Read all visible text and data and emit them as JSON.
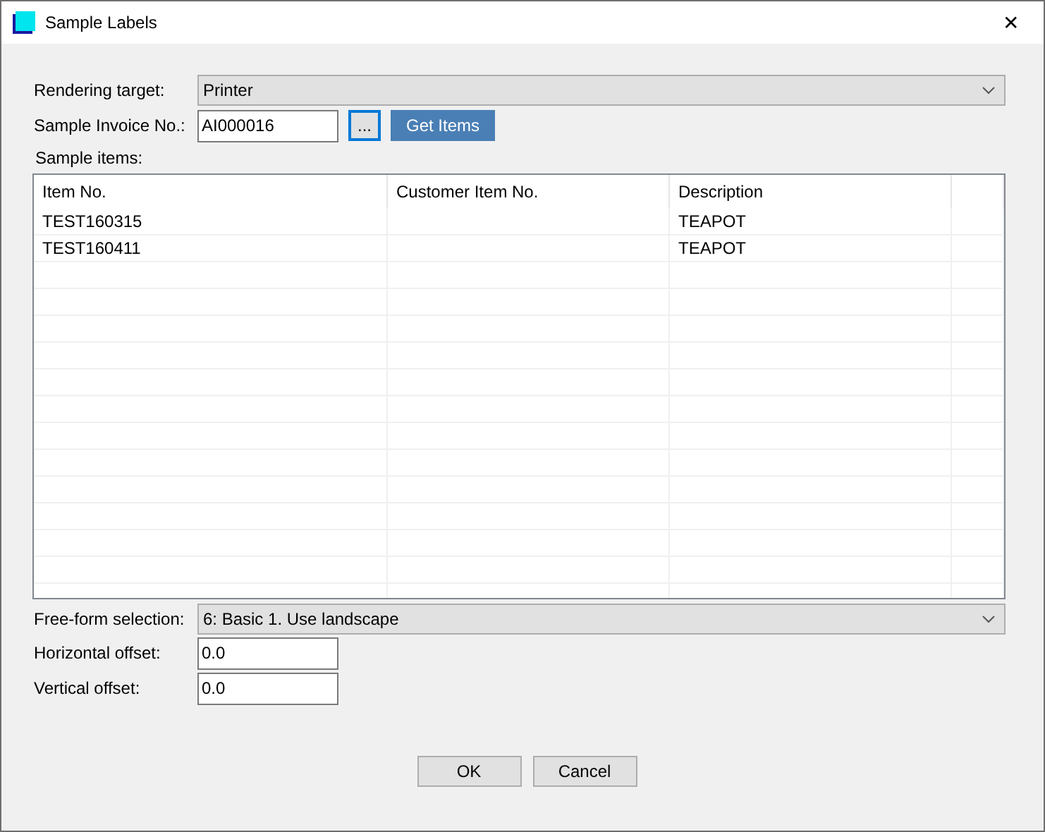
{
  "window": {
    "title": "Sample Labels",
    "close": "✕"
  },
  "rendering_target": {
    "label": "Rendering target:",
    "value": "Printer"
  },
  "invoice": {
    "label": "Sample Invoice No.:",
    "value": "AI000016",
    "browse_button": {
      "label": "...",
      "focused": true
    },
    "get_items_button": "Get Items"
  },
  "items": {
    "label": "Sample items:",
    "columns": [
      "Item No.",
      "Customer Item No.",
      "Description"
    ],
    "rows": [
      [
        "TEST160315",
        "",
        "TEAPOT"
      ],
      [
        "TEST160411",
        "",
        "TEAPOT"
      ]
    ]
  },
  "free_form": {
    "label": "Free-form selection:",
    "value": "6: Basic 1. Use landscape"
  },
  "horizontal_offset": {
    "label": "Horizontal offset:",
    "value": "0.0"
  },
  "vertical_offset": {
    "label": "Vertical offset:",
    "value": "0.0"
  },
  "buttons": [
    "OK",
    "Cancel"
  ]
}
